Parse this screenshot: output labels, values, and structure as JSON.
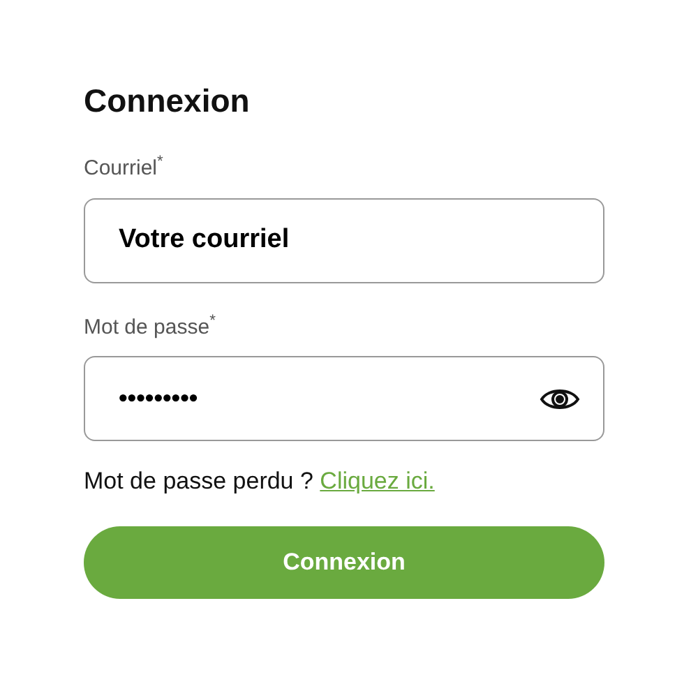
{
  "title": "Connexion",
  "fields": [
    {
      "label": "Courriel$^{*}$",
      "kind": "text",
      "placeholder": "Votre courriel"
    },
    {
      "label": "Mot de passe$^{*}$",
      "kind": "password",
      "value": "•••••••••"
    }
  ],
  "lost_password": {
    "text": "Mot de passe perdu ? ",
    "link": "Cliquez ici."
  },
  "submit": "Connexion"
}
